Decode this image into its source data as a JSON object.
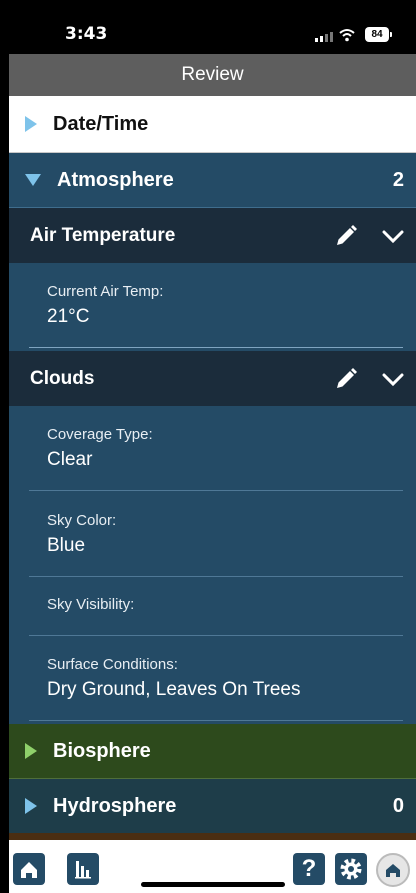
{
  "status_bar": {
    "time": "3:43",
    "battery": "84"
  },
  "header": {
    "title": "Review"
  },
  "sections": [
    {
      "label": "Date/Time",
      "count": ""
    },
    {
      "label": "Atmosphere",
      "count": "2"
    },
    {
      "label": "Biosphere",
      "count": ""
    },
    {
      "label": "Hydrosphere",
      "count": "0"
    }
  ],
  "air_temperature": {
    "title": "Air Temperature",
    "fields": [
      {
        "label": "Current Air Temp:",
        "value": "21°C"
      }
    ]
  },
  "clouds": {
    "title": "Clouds",
    "fields": [
      {
        "label": "Coverage Type:",
        "value": "Clear"
      },
      {
        "label": "Sky Color:",
        "value": "Blue"
      },
      {
        "label": "Sky Visibility:",
        "value": ""
      },
      {
        "label": "Surface Conditions:",
        "value": "Dry Ground, Leaves On Trees"
      }
    ]
  },
  "toolbar": {
    "help_label": "?"
  },
  "colors": {
    "atmosphere": "#244b66",
    "subheader": "#1b2c3b",
    "biosphere": "#2d4a1c",
    "hydrosphere": "#1e3d49",
    "accent_triangle": "#7ec3ea"
  }
}
